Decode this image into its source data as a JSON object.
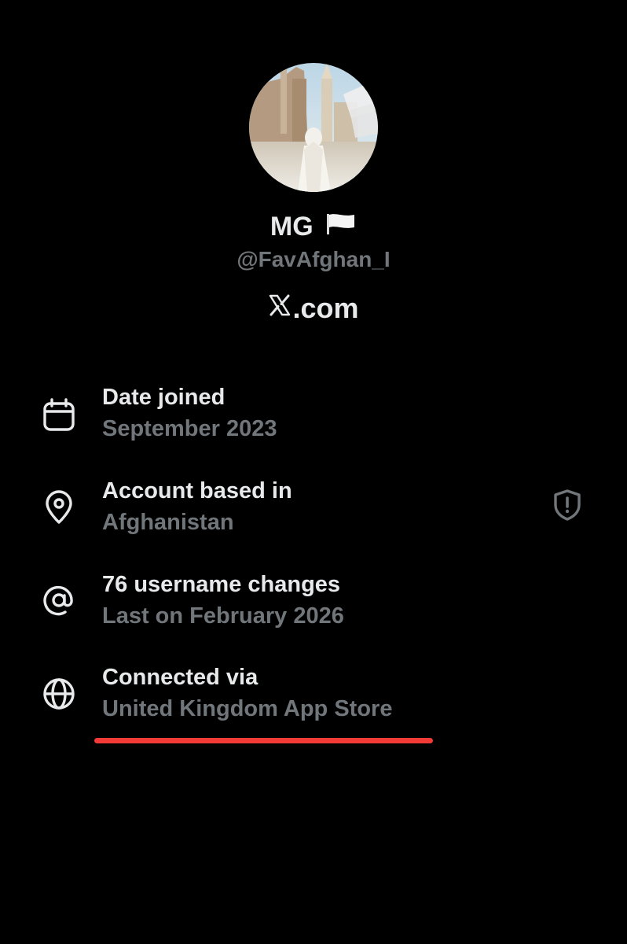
{
  "profile": {
    "display_name": "MG",
    "handle": "@FavAfghan_I",
    "site": ".com"
  },
  "icons": {
    "avatar": "profile-photo",
    "flag": "white-flag-icon",
    "site_logo": "x-logo-icon",
    "date_joined": "calendar-icon",
    "location": "location-pin-icon",
    "username": "at-sign-icon",
    "connected": "globe-icon",
    "shield": "shield-alert-icon"
  },
  "rows": [
    {
      "title": "Date joined",
      "value": "September 2023"
    },
    {
      "title": "Account based in",
      "value": "Afghanistan"
    },
    {
      "title": "76 username changes",
      "value": "Last on February 2026"
    },
    {
      "title": "Connected via",
      "value": "United Kingdom App Store"
    }
  ],
  "colors": {
    "background": "#000000",
    "primary_text": "#e7e9ea",
    "secondary_text": "#71767b",
    "highlight": "#f23a36"
  }
}
